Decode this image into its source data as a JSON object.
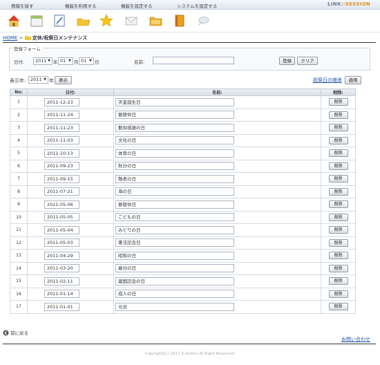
{
  "topnav": {
    "menu": [
      "情報を探す",
      "機能を利用する",
      "機能を設定する",
      "システムを設定する"
    ],
    "brand_main": "LINK",
    "brand_accent": "::SESSION"
  },
  "toolbar_icons": [
    "home-icon",
    "calendar-icon",
    "edit-icon",
    "folder-icon",
    "star-icon",
    "mail-icon",
    "folder-open-icon",
    "address-book-icon",
    "chat-icon"
  ],
  "breadcrumb": {
    "home": "HOME",
    "title": "定休/祝祭日メンテナンス"
  },
  "form": {
    "legend": "登録フォーム",
    "date_label": "日付:",
    "year": "2011",
    "year_unit": "年",
    "month": "01",
    "month_unit": "月",
    "day": "01",
    "day_unit": "日",
    "name_label": "名前:",
    "name_value": "",
    "register_button": "登録",
    "clear_button": "クリア"
  },
  "filter": {
    "display_year_label": "表示年:",
    "year": "2011",
    "year_unit": "年",
    "show_button": "表示",
    "holiday_link": "祝祭日の継承",
    "apply_button": "適用"
  },
  "table": {
    "headers": {
      "no": "No:",
      "date": "日付:",
      "name": "名前:",
      "delete": "削除:"
    },
    "delete_label": "削除",
    "rows": [
      {
        "no": "1",
        "date": "2011-12-23",
        "name": "天皇誕生日"
      },
      {
        "no": "2",
        "date": "2011-11-24",
        "name": "振替休日"
      },
      {
        "no": "3",
        "date": "2011-11-23",
        "name": "勤労感謝の日"
      },
      {
        "no": "4",
        "date": "2011-11-03",
        "name": "文化の日"
      },
      {
        "no": "5",
        "date": "2011-10-13",
        "name": "体育の日"
      },
      {
        "no": "6",
        "date": "2011-09-23",
        "name": "秋分の日"
      },
      {
        "no": "7",
        "date": "2011-09-15",
        "name": "敬老の日"
      },
      {
        "no": "8",
        "date": "2011-07-21",
        "name": "海の日"
      },
      {
        "no": "9",
        "date": "2011-05-06",
        "name": "振替休日"
      },
      {
        "no": "10",
        "date": "2011-05-05",
        "name": "こどもの日"
      },
      {
        "no": "11",
        "date": "2011-05-04",
        "name": "みどりの日"
      },
      {
        "no": "12",
        "date": "2011-05-03",
        "name": "憲法記念日"
      },
      {
        "no": "13",
        "date": "2011-04-29",
        "name": "昭和の日"
      },
      {
        "no": "14",
        "date": "2011-03-20",
        "name": "春分の日"
      },
      {
        "no": "15",
        "date": "2011-02-11",
        "name": "建国記念の日"
      },
      {
        "no": "16",
        "date": "2011-01-14",
        "name": "成人の日"
      },
      {
        "no": "17",
        "date": "2011-01-01",
        "name": "元旦"
      }
    ]
  },
  "footer": {
    "back": "前に戻る",
    "contact": "お問い合わせ",
    "copyright": "Copyright(C) 2011 in Action All Right Reserved."
  }
}
